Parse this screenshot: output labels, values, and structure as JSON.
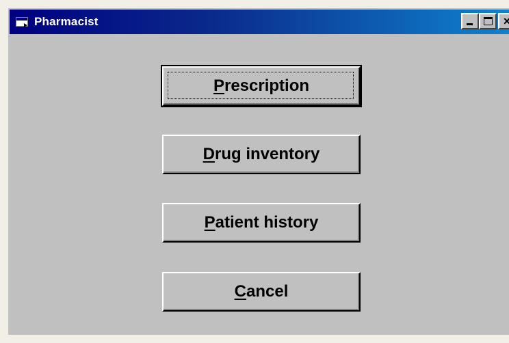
{
  "window": {
    "title": "Pharmacist",
    "icon": "application-window-icon",
    "controls": {
      "minimize": "_",
      "maximize": "□",
      "close": "×"
    }
  },
  "buttons": [
    {
      "id": "prescription",
      "accel": "P",
      "rest": "rescription",
      "default": true
    },
    {
      "id": "drug-inventory",
      "accel": "D",
      "rest": "rug inventory",
      "default": false
    },
    {
      "id": "patient-history",
      "accel": "P",
      "rest": "atient history",
      "default": false
    },
    {
      "id": "cancel",
      "accel": "C",
      "rest": "ancel",
      "default": false
    }
  ],
  "colors": {
    "titlebar_start": "#000080",
    "titlebar_end": "#1084d0",
    "face": "#c0c0c0",
    "outer_frame": "#f2f0e6"
  }
}
